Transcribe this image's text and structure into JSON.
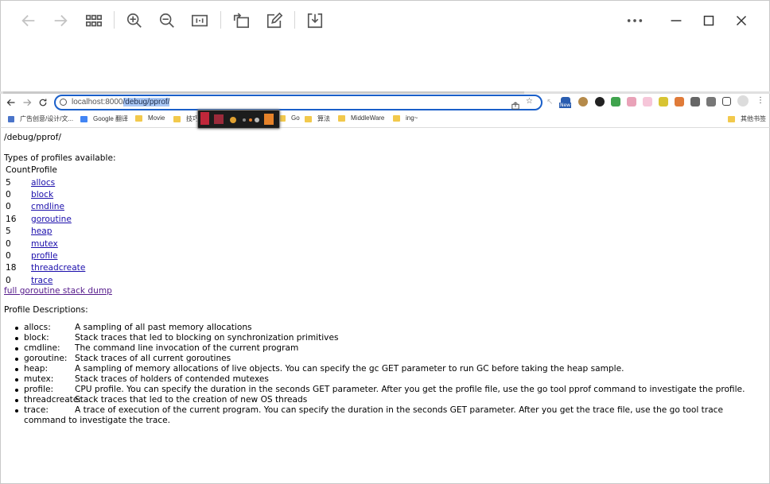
{
  "viewer": {
    "icons": [
      "back-arrow-icon",
      "forward-arrow-icon",
      "grid-icon",
      "zoom-in-icon",
      "zoom-out-icon",
      "fit-page-icon",
      "rotate-icon",
      "edit-icon",
      "download-icon",
      "more-icon",
      "minimize-icon",
      "maximize-icon",
      "close-icon"
    ]
  },
  "browser": {
    "address": {
      "host": "localhost:8000",
      "path": "/debug/pprof/"
    },
    "badge_new": "New",
    "bookmarks": [
      {
        "label": "广告创意/设计/文..."
      },
      {
        "label": "Google 翻译"
      },
      {
        "label": "Movie"
      },
      {
        "label": "技巧"
      },
      {
        "label": "Go"
      },
      {
        "label": "算法"
      },
      {
        "label": "MiddleWare"
      },
      {
        "label": "ing~"
      },
      {
        "label": "其他书签"
      }
    ]
  },
  "page": {
    "title": "/debug/pprof/",
    "types_heading": "Types of profiles available:",
    "table": {
      "headers": [
        "Count",
        "Profile"
      ],
      "rows": [
        {
          "count": "5",
          "name": "allocs"
        },
        {
          "count": "0",
          "name": "block"
        },
        {
          "count": "0",
          "name": "cmdline"
        },
        {
          "count": "16",
          "name": "goroutine"
        },
        {
          "count": "5",
          "name": "heap"
        },
        {
          "count": "0",
          "name": "mutex"
        },
        {
          "count": "0",
          "name": "profile"
        },
        {
          "count": "18",
          "name": "threadcreate"
        },
        {
          "count": "0",
          "name": "trace"
        }
      ]
    },
    "full_dump_link": "full goroutine stack dump",
    "desc_heading": "Profile Descriptions:",
    "descriptions": [
      {
        "name": "allocs:",
        "text": "A sampling of all past memory allocations"
      },
      {
        "name": "block:",
        "text": "Stack traces that led to blocking on synchronization primitives"
      },
      {
        "name": "cmdline:",
        "text": "The command line invocation of the current program"
      },
      {
        "name": "goroutine:",
        "text": "Stack traces of all current goroutines"
      },
      {
        "name": "heap:",
        "text": "A sampling of memory allocations of live objects. You can specify the gc GET parameter to run GC before taking the heap sample."
      },
      {
        "name": "mutex:",
        "text": "Stack traces of holders of contended mutexes"
      },
      {
        "name": "profile:",
        "text": "CPU profile. You can specify the duration in the seconds GET parameter. After you get the profile file, use the go tool pprof command to investigate the profile."
      },
      {
        "name": "threadcreate:",
        "text": "Stack traces that led to the creation of new OS threads"
      },
      {
        "name": "trace:",
        "text": "A trace of execution of the current program. You can specify the duration in the seconds GET parameter. After you get the trace file, use the go tool trace command to investigate the trace."
      }
    ]
  }
}
